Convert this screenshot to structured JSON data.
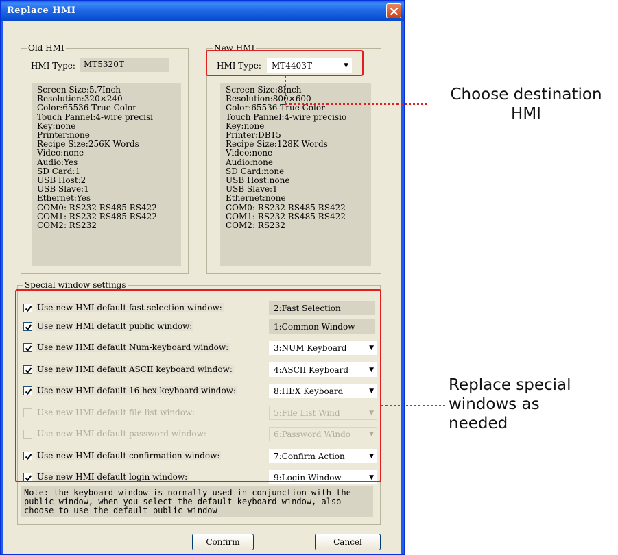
{
  "window": {
    "title": "Replace HMI"
  },
  "old_hmi": {
    "group_title": "Old HMI",
    "type_label": "HMI Type:",
    "type_value": "MT5320T",
    "specs": "Screen Size:5.7Inch\nResolution:320×240\nColor:65536 True Color\nTouch Pannel:4-wire precisi\nKey:none\nPrinter:none\nRecipe Size:256K Words\nVideo:none\nAudio:Yes\nSD Card:1\nUSB Host:2\nUSB Slave:1\nEthernet:Yes\nCOM0: RS232 RS485 RS422\nCOM1: RS232 RS485 RS422\nCOM2: RS232"
  },
  "new_hmi": {
    "group_title": "New HMI",
    "type_label": "HMI Type:",
    "type_value": "MT4403T",
    "specs": "Screen Size:8Inch\nResolution:800×600\nColor:65536 True Color\nTouch Pannel:4-wire precisio\nKey:none\nPrinter:DB15\nRecipe Size:128K Words\nVideo:none\nAudio:none\nSD Card:none\nUSB Host:none\nUSB Slave:1\nEthernet:none\nCOM0: RS232 RS485 RS422\nCOM1: RS232 RS485 RS422\nCOM2: RS232"
  },
  "special": {
    "group_title": "Special window settings",
    "rows": [
      {
        "label": "Use new HMI default fast selection window:",
        "value": "2:Fast Selection",
        "checked": true,
        "enabled": true,
        "dropdown": false
      },
      {
        "label": "Use new HMI default public window:",
        "value": "1:Common Window",
        "checked": true,
        "enabled": true,
        "dropdown": false
      },
      {
        "label": "Use new HMI default Num-keyboard window:",
        "value": "3:NUM Keyboard",
        "checked": true,
        "enabled": true,
        "dropdown": true
      },
      {
        "label": "Use new HMI default ASCII keyboard window:",
        "value": "4:ASCII Keyboard",
        "checked": true,
        "enabled": true,
        "dropdown": true
      },
      {
        "label": "Use new HMI default 16 hex keyboard window:",
        "value": "8:HEX Keyboard",
        "checked": true,
        "enabled": true,
        "dropdown": true
      },
      {
        "label": "Use new HMI default file list window:",
        "value": "5:File List Wind",
        "checked": false,
        "enabled": false,
        "dropdown": true
      },
      {
        "label": "Use new HMI default password window:",
        "value": "6:Password Windo",
        "checked": false,
        "enabled": false,
        "dropdown": true
      },
      {
        "label": "Use new HMI default confirmation window:",
        "value": "7:Confirm Action",
        "checked": true,
        "enabled": true,
        "dropdown": true
      },
      {
        "label": "Use new HMI default login window:",
        "value": "9:Login Window",
        "checked": true,
        "enabled": true,
        "dropdown": true
      }
    ]
  },
  "note": "Note: the keyboard window is normally used in conjunction with the public window, when you select the default keyboard window, also choose to use the default public window",
  "buttons": {
    "confirm": "Confirm",
    "cancel": "Cancel"
  },
  "annotations": {
    "choose": "Choose destination\nHMI",
    "replace": "Replace special\nwindows as\nneeded"
  },
  "colors": {
    "accent_red": "#e02020",
    "title_blue": "#0c53d4"
  }
}
